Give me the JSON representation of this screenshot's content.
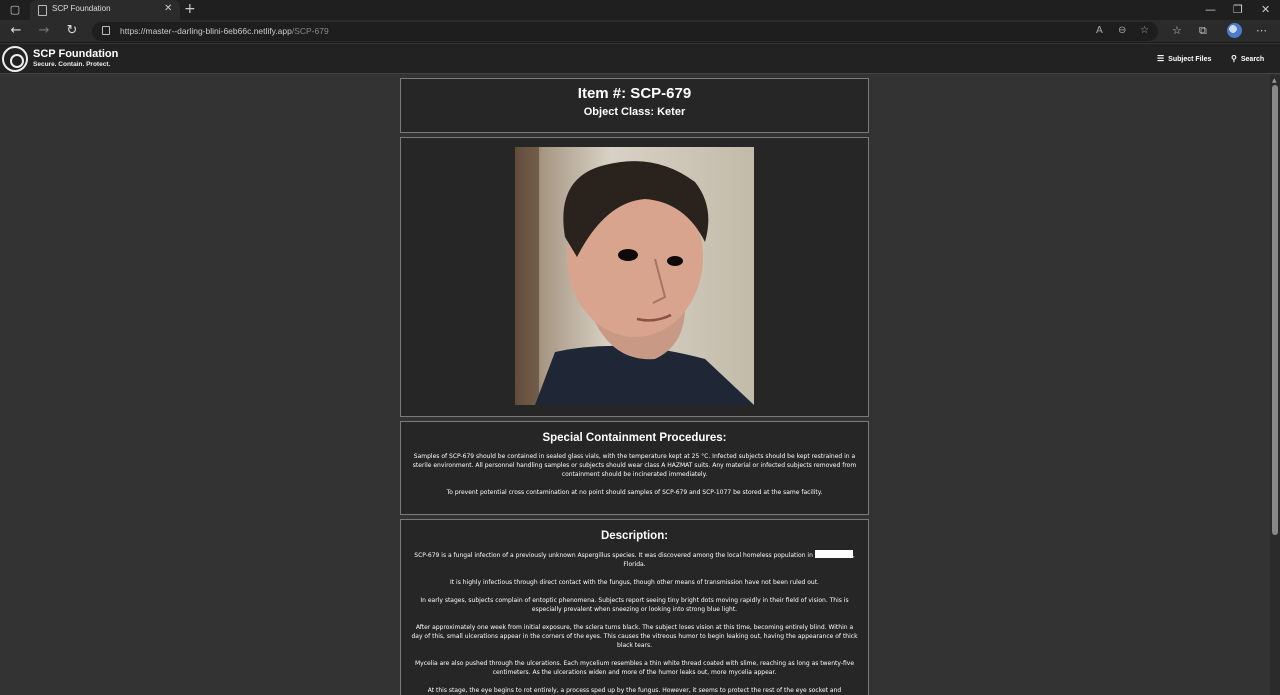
{
  "browser": {
    "tab_title": "SCP Foundation",
    "url_host": "https://master--darling-blini-6eb66c.netlify.app",
    "url_path": "/SCP-679"
  },
  "site": {
    "brand_name": "SCP Foundation",
    "brand_tagline": "Secure. Contain. Protect.",
    "nav": {
      "subject_files": "Subject Files",
      "search": "Search"
    }
  },
  "document": {
    "item_title": "Item #: SCP-679",
    "object_class": "Object Class: Keter",
    "containment": {
      "heading": "Special Containment Procedures:",
      "paragraphs": [
        "Samples of SCP-679 should be contained in sealed glass vials, with the temperature kept at 25 °C. Infected subjects should be kept restrained in a sterile environment. All personnel handling samples or subjects should wear class A HAZMAT suits. Any material or infected subjects removed from containment should be incinerated immediately.",
        "To prevent potential cross contamination at no point should samples of SCP-679 and SCP-1077 be stored at the same facility."
      ]
    },
    "description": {
      "heading": "Description:",
      "p1_before": "SCP-679 is a fungal infection of a previously unknown Aspergillus species. It was discovered among the local homeless population in",
      "p1_after": ", Florida.",
      "paragraphs": [
        "It is highly infectious through direct contact with the fungus, though other means of transmission have not been ruled out.",
        "In early stages, subjects complain of entoptic phenomena. Subjects report seeing tiny bright dots moving rapidly in their field of vision. This is especially prevalent when sneezing or looking into strong blue light.",
        "After approximately one week from initial exposure, the sclera turns black. The subject loses vision at this time, becoming entirely blind. Within a day of this, small ulcerations appear in the corners of the eyes. This causes the vitreous humor to begin leaking out, having the appearance of thick black tears.",
        "Mycelia are also pushed through the ulcerations. Each mycelium resembles a thin white thread coated with slime, reaching as long as twenty-five centimeters. As the ulcerations widen and more of the humor leaks out, more mycelia appear.",
        "At this stage, the eye begins to rot entirely, a process sped up by the fungus. However, it seems to protect the rest of the eye socket and"
      ]
    }
  },
  "icons": {
    "logo": "scp-logo-icon",
    "menu": "hamburger-icon",
    "search": "search-icon"
  }
}
